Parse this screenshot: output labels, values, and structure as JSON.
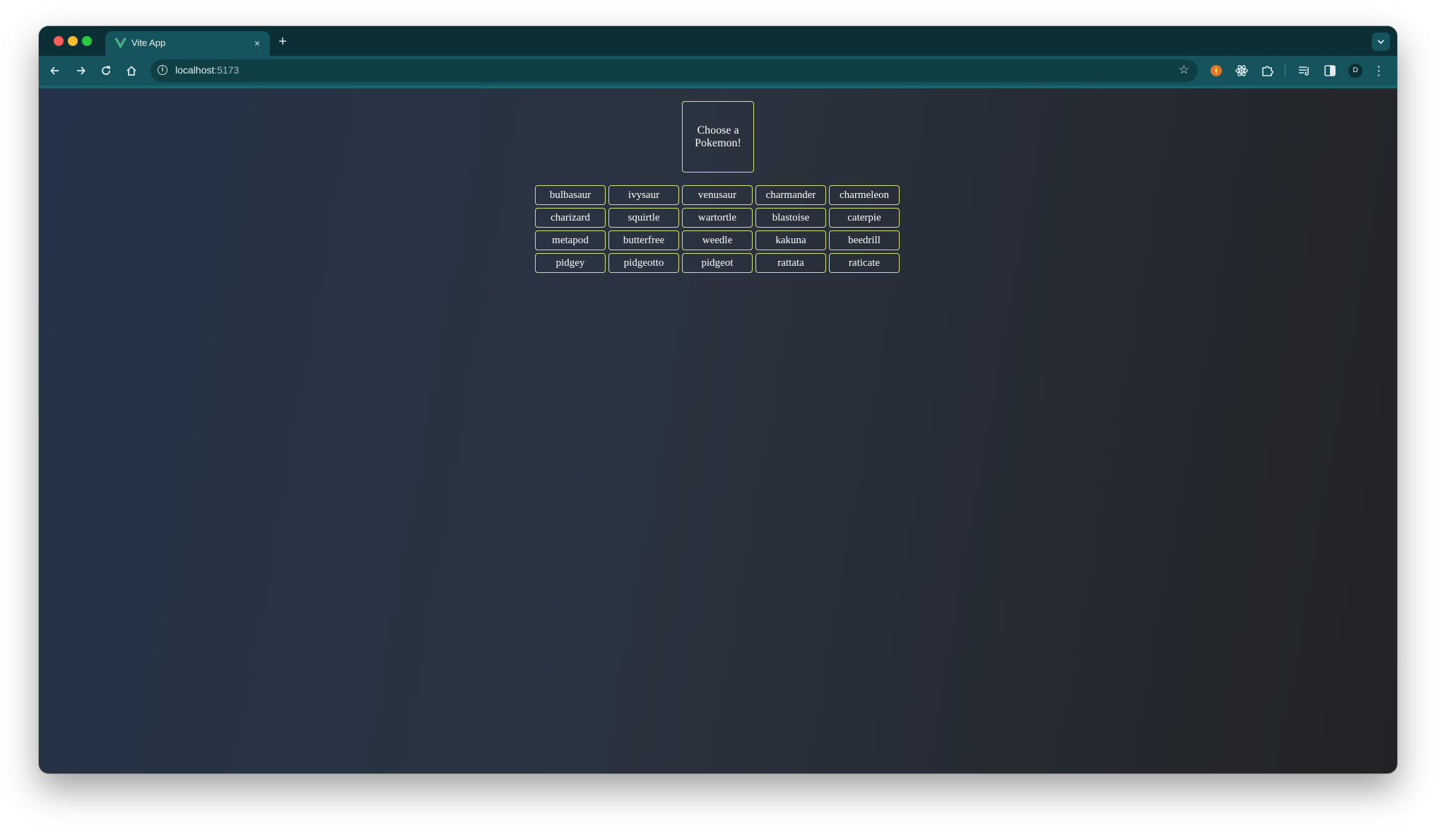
{
  "browser": {
    "tab": {
      "title": "Vite App",
      "close_glyph": "×"
    },
    "new_tab_glyph": "+",
    "tab_search_glyph": "⌄",
    "url_host": "localhost",
    "url_port": ":5173",
    "profile_initial": "D",
    "icons": [
      "back-arrow-icon",
      "forward-arrow-icon",
      "reload-icon",
      "home-icon",
      "site-info-icon",
      "bookmark-star-icon",
      "extension-icon",
      "puzzle-icon",
      "media-icon",
      "side-panel-icon",
      "menu-icon"
    ],
    "colors": {
      "frame": "#0b2f34",
      "toolbar": "#15545c",
      "omnibox": "#0d3f45"
    }
  },
  "app": {
    "heading": "Choose a Pokemon!",
    "accent_color": "#d8e27a",
    "pokemon": [
      "bulbasaur",
      "ivysaur",
      "venusaur",
      "charmander",
      "charmeleon",
      "charizard",
      "squirtle",
      "wartortle",
      "blastoise",
      "caterpie",
      "metapod",
      "butterfree",
      "weedle",
      "kakuna",
      "beedrill",
      "pidgey",
      "pidgeotto",
      "pidgeot",
      "rattata",
      "raticate"
    ]
  }
}
